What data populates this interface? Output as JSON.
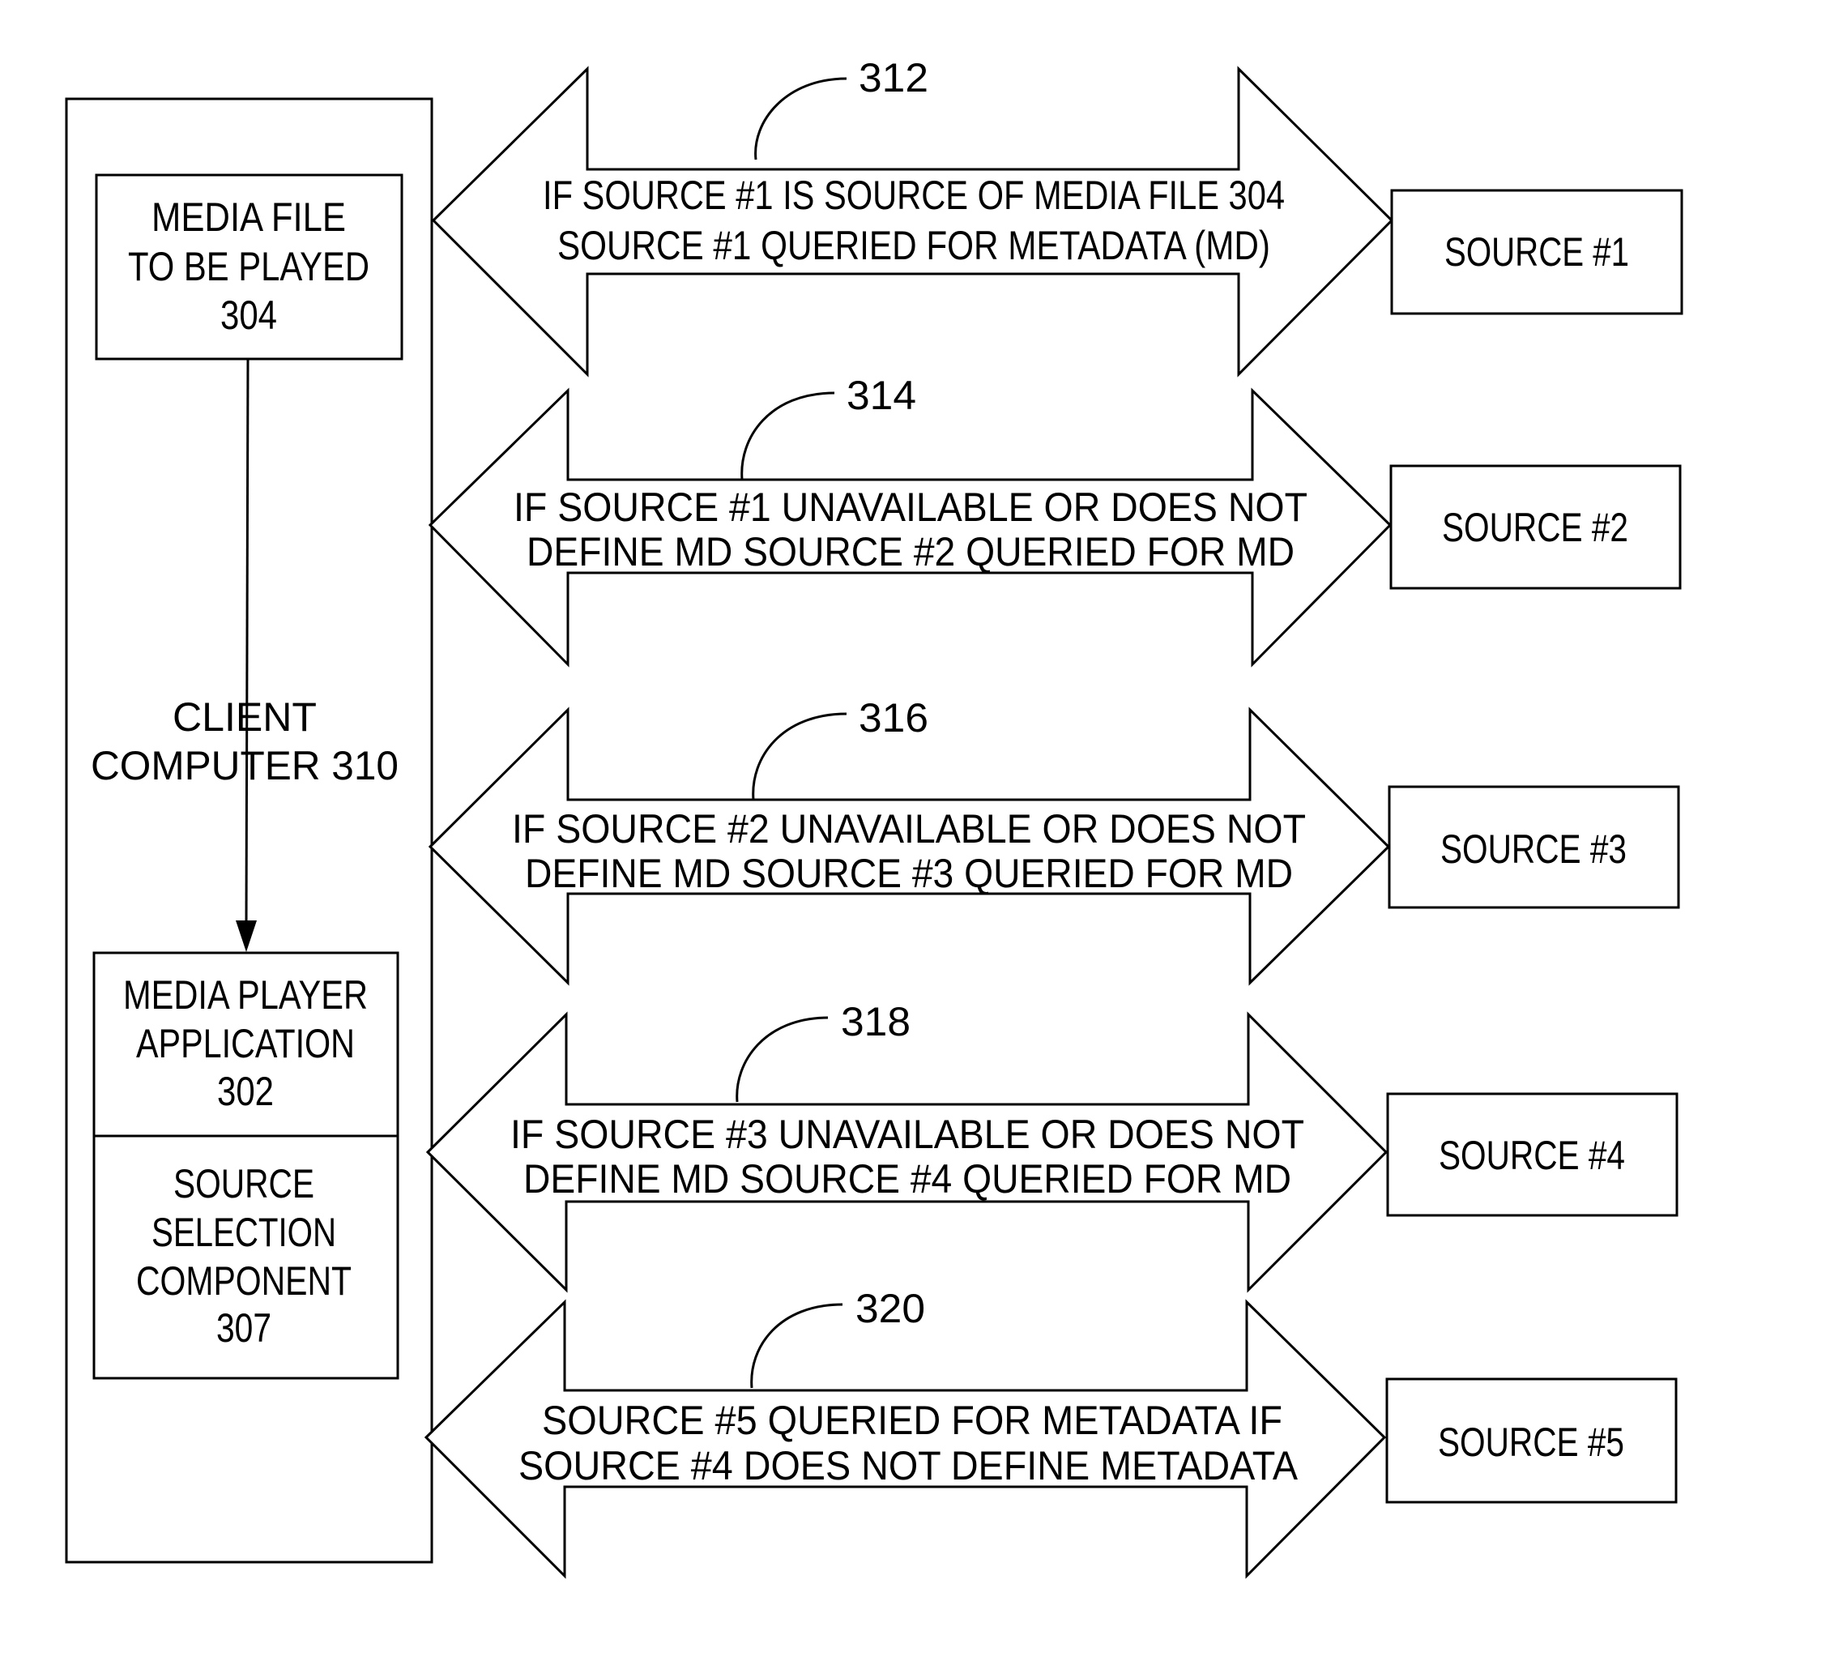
{
  "client": {
    "label_lines": [
      "CLIENT",
      "COMPUTER 310"
    ],
    "media_file": {
      "lines": [
        "MEDIA FILE",
        "TO BE PLAYED",
        "304"
      ]
    },
    "media_player": {
      "lines": [
        "MEDIA PLAYER",
        "APPLICATION",
        "302"
      ]
    },
    "source_selection": {
      "lines": [
        "SOURCE",
        "SELECTION",
        "COMPONENT",
        "307"
      ]
    }
  },
  "queries": [
    {
      "ref": "312",
      "lines": [
        "IF SOURCE #1 IS SOURCE OF MEDIA FILE 304",
        "SOURCE #1 QUERIED FOR METADATA (MD)"
      ],
      "source": "SOURCE #1"
    },
    {
      "ref": "314",
      "lines": [
        "IF SOURCE #1 UNAVAILABLE OR DOES NOT",
        "DEFINE MD SOURCE #2 QUERIED FOR MD"
      ],
      "source": "SOURCE #2"
    },
    {
      "ref": "316",
      "lines": [
        "IF SOURCE #2 UNAVAILABLE OR DOES NOT",
        "DEFINE MD SOURCE #3 QUERIED FOR MD"
      ],
      "source": "SOURCE #3"
    },
    {
      "ref": "318",
      "lines": [
        "IF SOURCE #3 UNAVAILABLE OR DOES NOT",
        "DEFINE MD SOURCE #4 QUERIED FOR MD"
      ],
      "source": "SOURCE #4"
    },
    {
      "ref": "320",
      "lines": [
        "SOURCE #5 QUERIED FOR METADATA IF",
        "SOURCE #4 DOES NOT DEFINE METADATA"
      ],
      "source": "SOURCE #5"
    }
  ]
}
